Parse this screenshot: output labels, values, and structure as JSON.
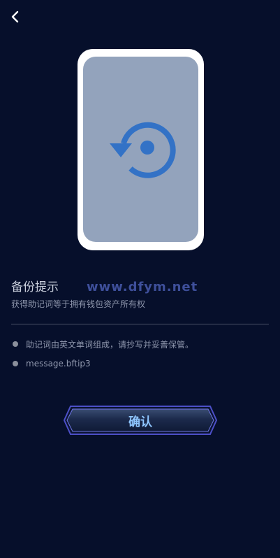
{
  "header": {
    "back_icon": "chevron-left-icon"
  },
  "illustration": {
    "icon": "backup-restore-icon",
    "frame_color": "#ffffff",
    "screen_color": "#93a3bc",
    "icon_color": "#3372c6"
  },
  "content": {
    "title": "备份提示",
    "subtitle": "获得助记词等于拥有钱包资产所有权",
    "watermark": "www.dfym.net",
    "tips": [
      "助记词由英文单词组成，请抄写并妥善保管。",
      "message.bftip3"
    ]
  },
  "actions": {
    "confirm_label": "确认"
  },
  "colors": {
    "background": "#060f2b",
    "accent": "#5a5fd6",
    "button_text": "#8fc6ff"
  }
}
